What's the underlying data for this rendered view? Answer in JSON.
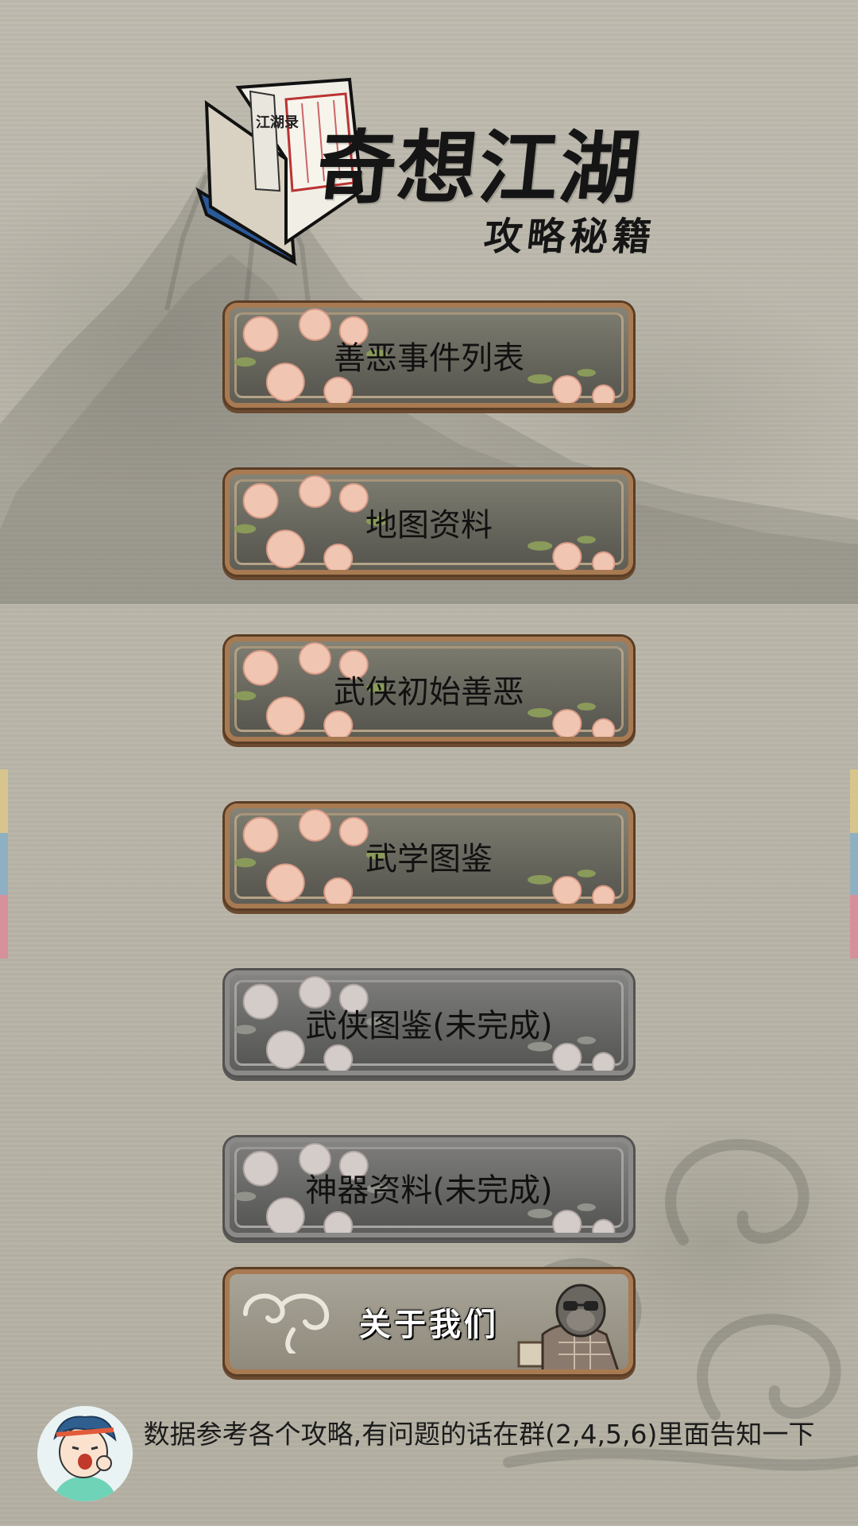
{
  "logo": {
    "title": "奇想江湖",
    "subtitle": "攻略秘籍",
    "book_text": "江湖录"
  },
  "menu": {
    "items": [
      {
        "label": "善恶事件列表",
        "enabled": true
      },
      {
        "label": "地图资料",
        "enabled": true
      },
      {
        "label": "武侠初始善恶",
        "enabled": true
      },
      {
        "label": "武学图鉴",
        "enabled": true
      },
      {
        "label": "武侠图鉴(未完成)",
        "enabled": false
      },
      {
        "label": "神器资料(未完成)",
        "enabled": false
      }
    ],
    "about_label": "关于我们"
  },
  "footer": {
    "note": "数据参考各个攻略,有问题的话在群(2,4,5,6)里面告知一下"
  },
  "colors": {
    "button_border": "#a87a52",
    "button_fill": "#6b6a60",
    "side_tab_yellow": "#d8c48d",
    "side_tab_blue": "#8fb0c2",
    "side_tab_pink": "#d6909a"
  }
}
